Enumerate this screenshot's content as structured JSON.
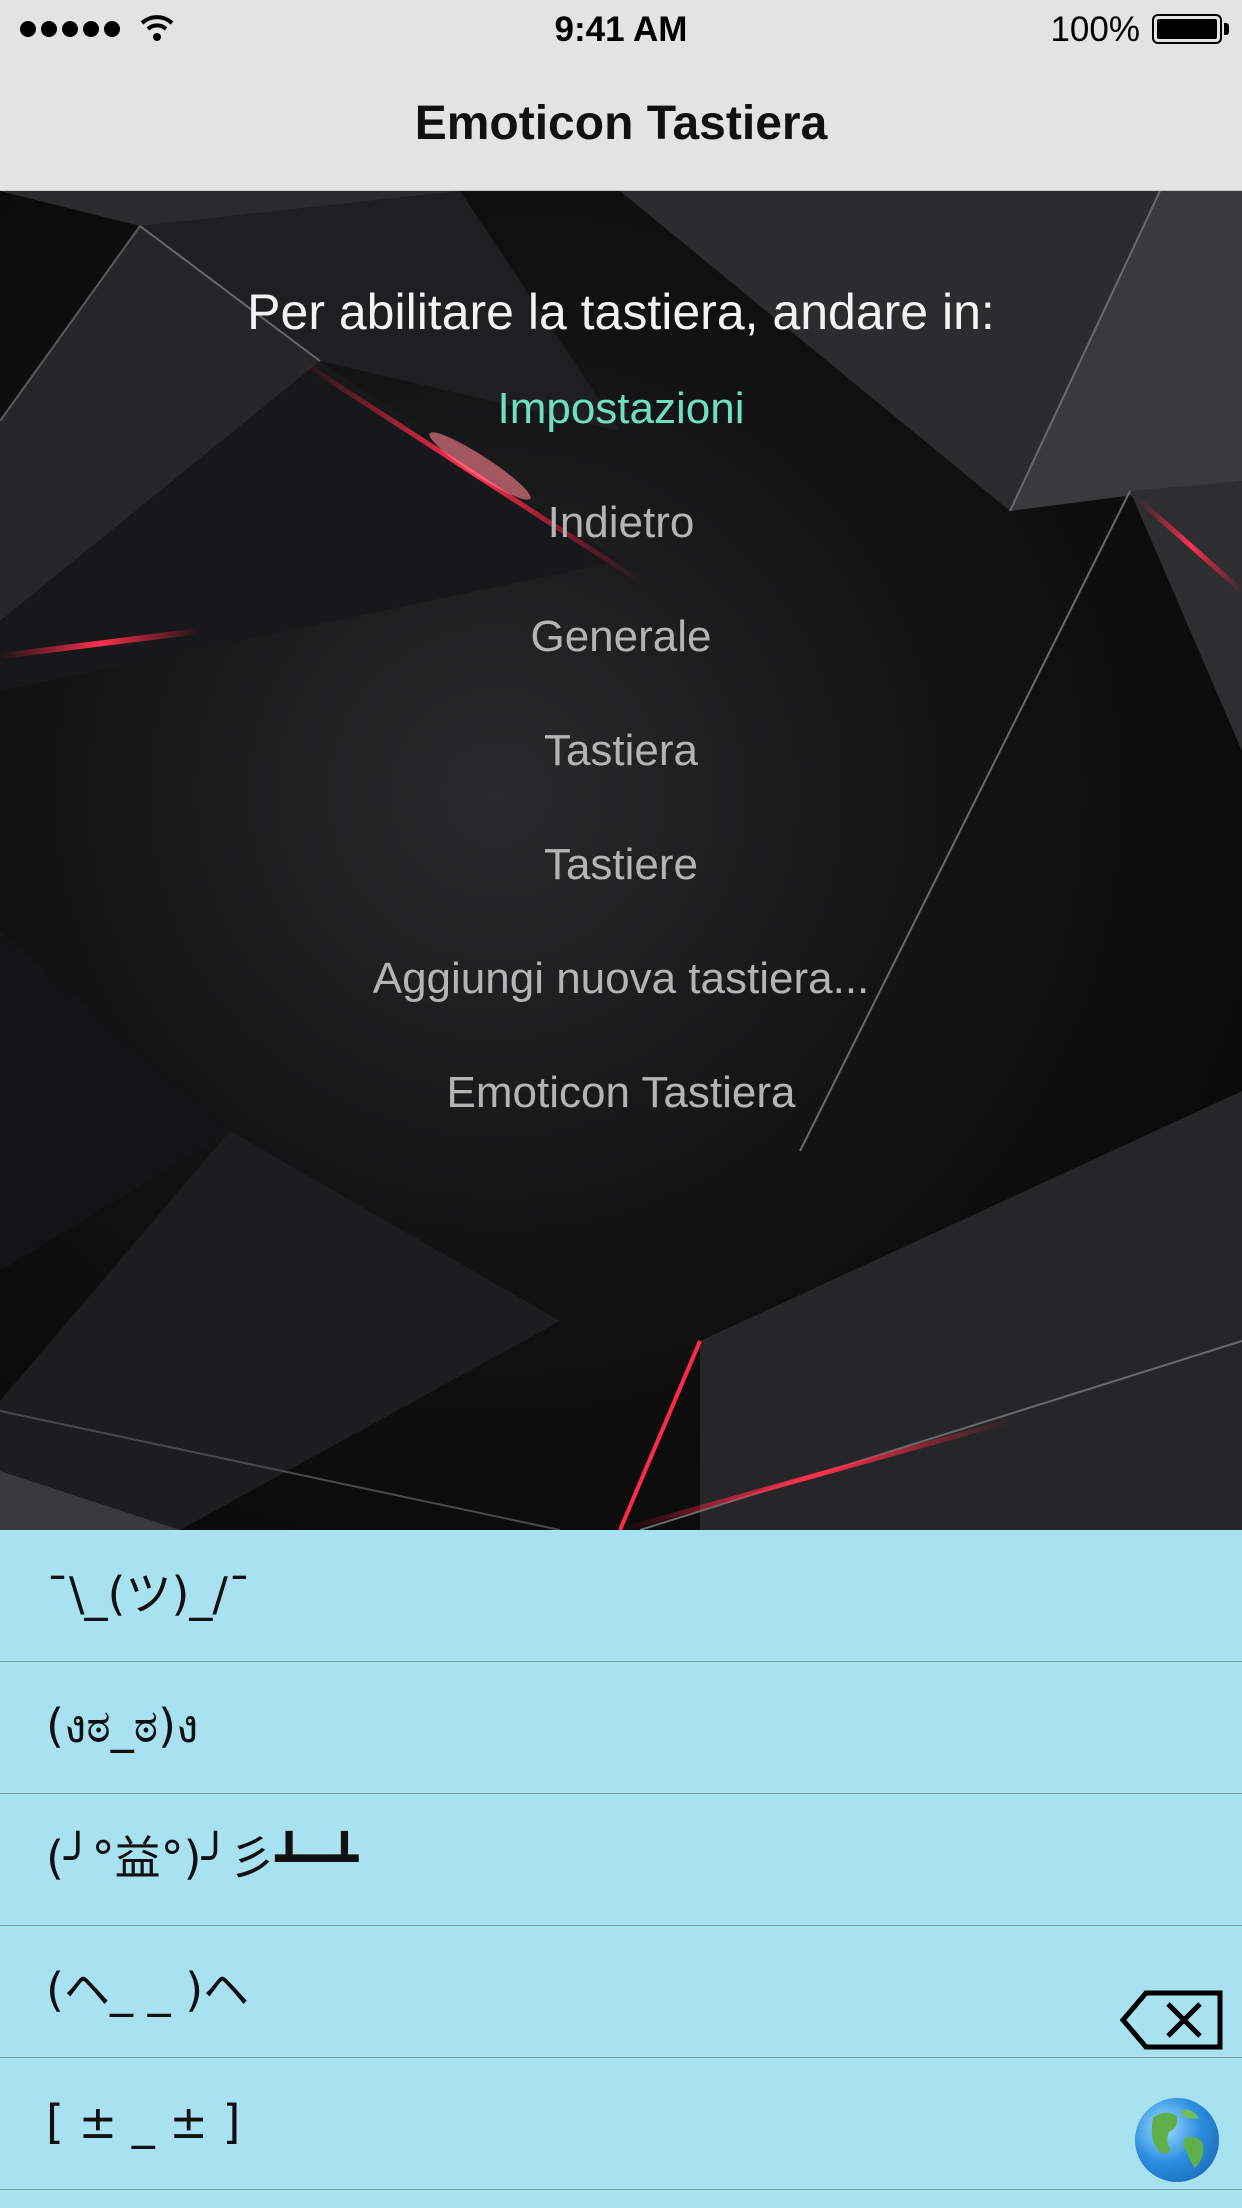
{
  "status_bar": {
    "time": "9:41 AM",
    "battery": "100%",
    "icons": [
      "signal-dots-icon",
      "wifi-icon",
      "battery-icon"
    ]
  },
  "nav": {
    "title": "Emoticon Tastiera"
  },
  "main": {
    "instructions": "Per abilitare la tastiera, andare in:",
    "steps": [
      {
        "label": "Impostazioni"
      },
      {
        "label": "Indietro"
      },
      {
        "label": "Generale"
      },
      {
        "label": "Tastiera"
      },
      {
        "label": "Tastiere"
      },
      {
        "label": "Aggiungi nuova tastiera..."
      },
      {
        "label": "Emoticon Tastiera"
      }
    ],
    "accent_color": "#6ee0c0"
  },
  "keyboard": {
    "background": "#a8e2f1",
    "emoticons": [
      "¯\\_(ツ)_/¯",
      "(งಠ_ಠ)ง",
      "(╯°益°)╯彡┻━┻",
      "(ヘ_ _ )ヘ",
      "[ ± _ ± ]"
    ],
    "keys": [
      "delete-key-icon",
      "globe-icon"
    ]
  }
}
